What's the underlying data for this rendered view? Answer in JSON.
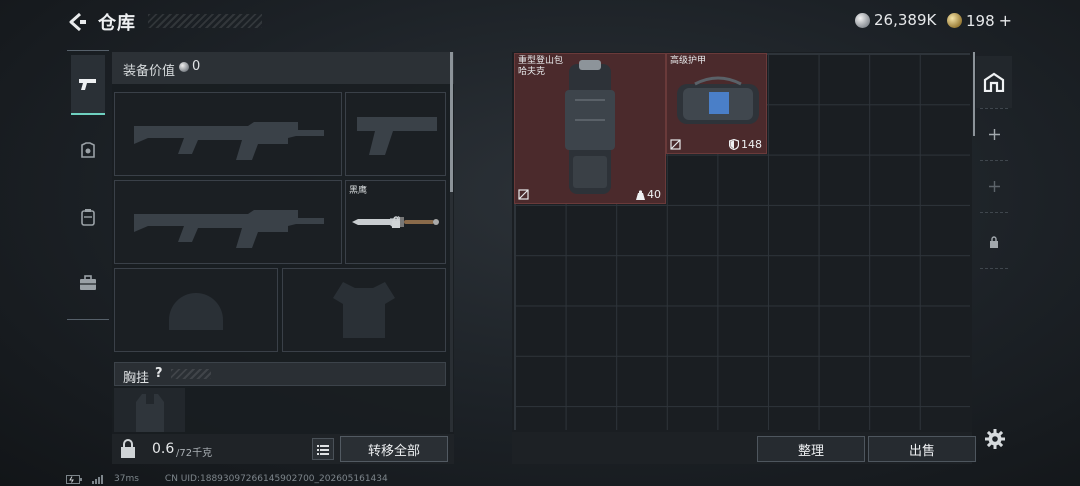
{
  "header": {
    "title": "仓库",
    "currency_silver": "26,389K",
    "currency_gold": "198",
    "add_currency_label": "+"
  },
  "equipment": {
    "value_label": "装备价值",
    "value": "0",
    "slots": {
      "melee_name": "黑鹰"
    },
    "chest_rig_label": "胸挂",
    "chest_rig_help": "?"
  },
  "weight": {
    "current": "0.6",
    "max": "/72千克"
  },
  "buttons": {
    "transfer_all": "转移全部",
    "sort": "整理",
    "sell": "出售"
  },
  "storage": {
    "items": [
      {
        "name_line1": "重型登山包",
        "name_line2": "哈夫克",
        "stat": "40",
        "stat_icon": "weight-icon"
      },
      {
        "name_line1": "高级护甲",
        "name_line2": "",
        "stat": "148",
        "stat_icon": "shield-icon"
      }
    ],
    "right_rail": [
      "home-icon",
      "plus-icon",
      "plus-icon",
      "lock-icon"
    ]
  },
  "status_bar": {
    "ping": "37ms",
    "uid": "CN UID:18893097266145902700_202605161434"
  },
  "colors": {
    "accent": "#6fd1c0",
    "item_bg": "#4b2a2c",
    "panel_bg": "#1a1e22"
  }
}
